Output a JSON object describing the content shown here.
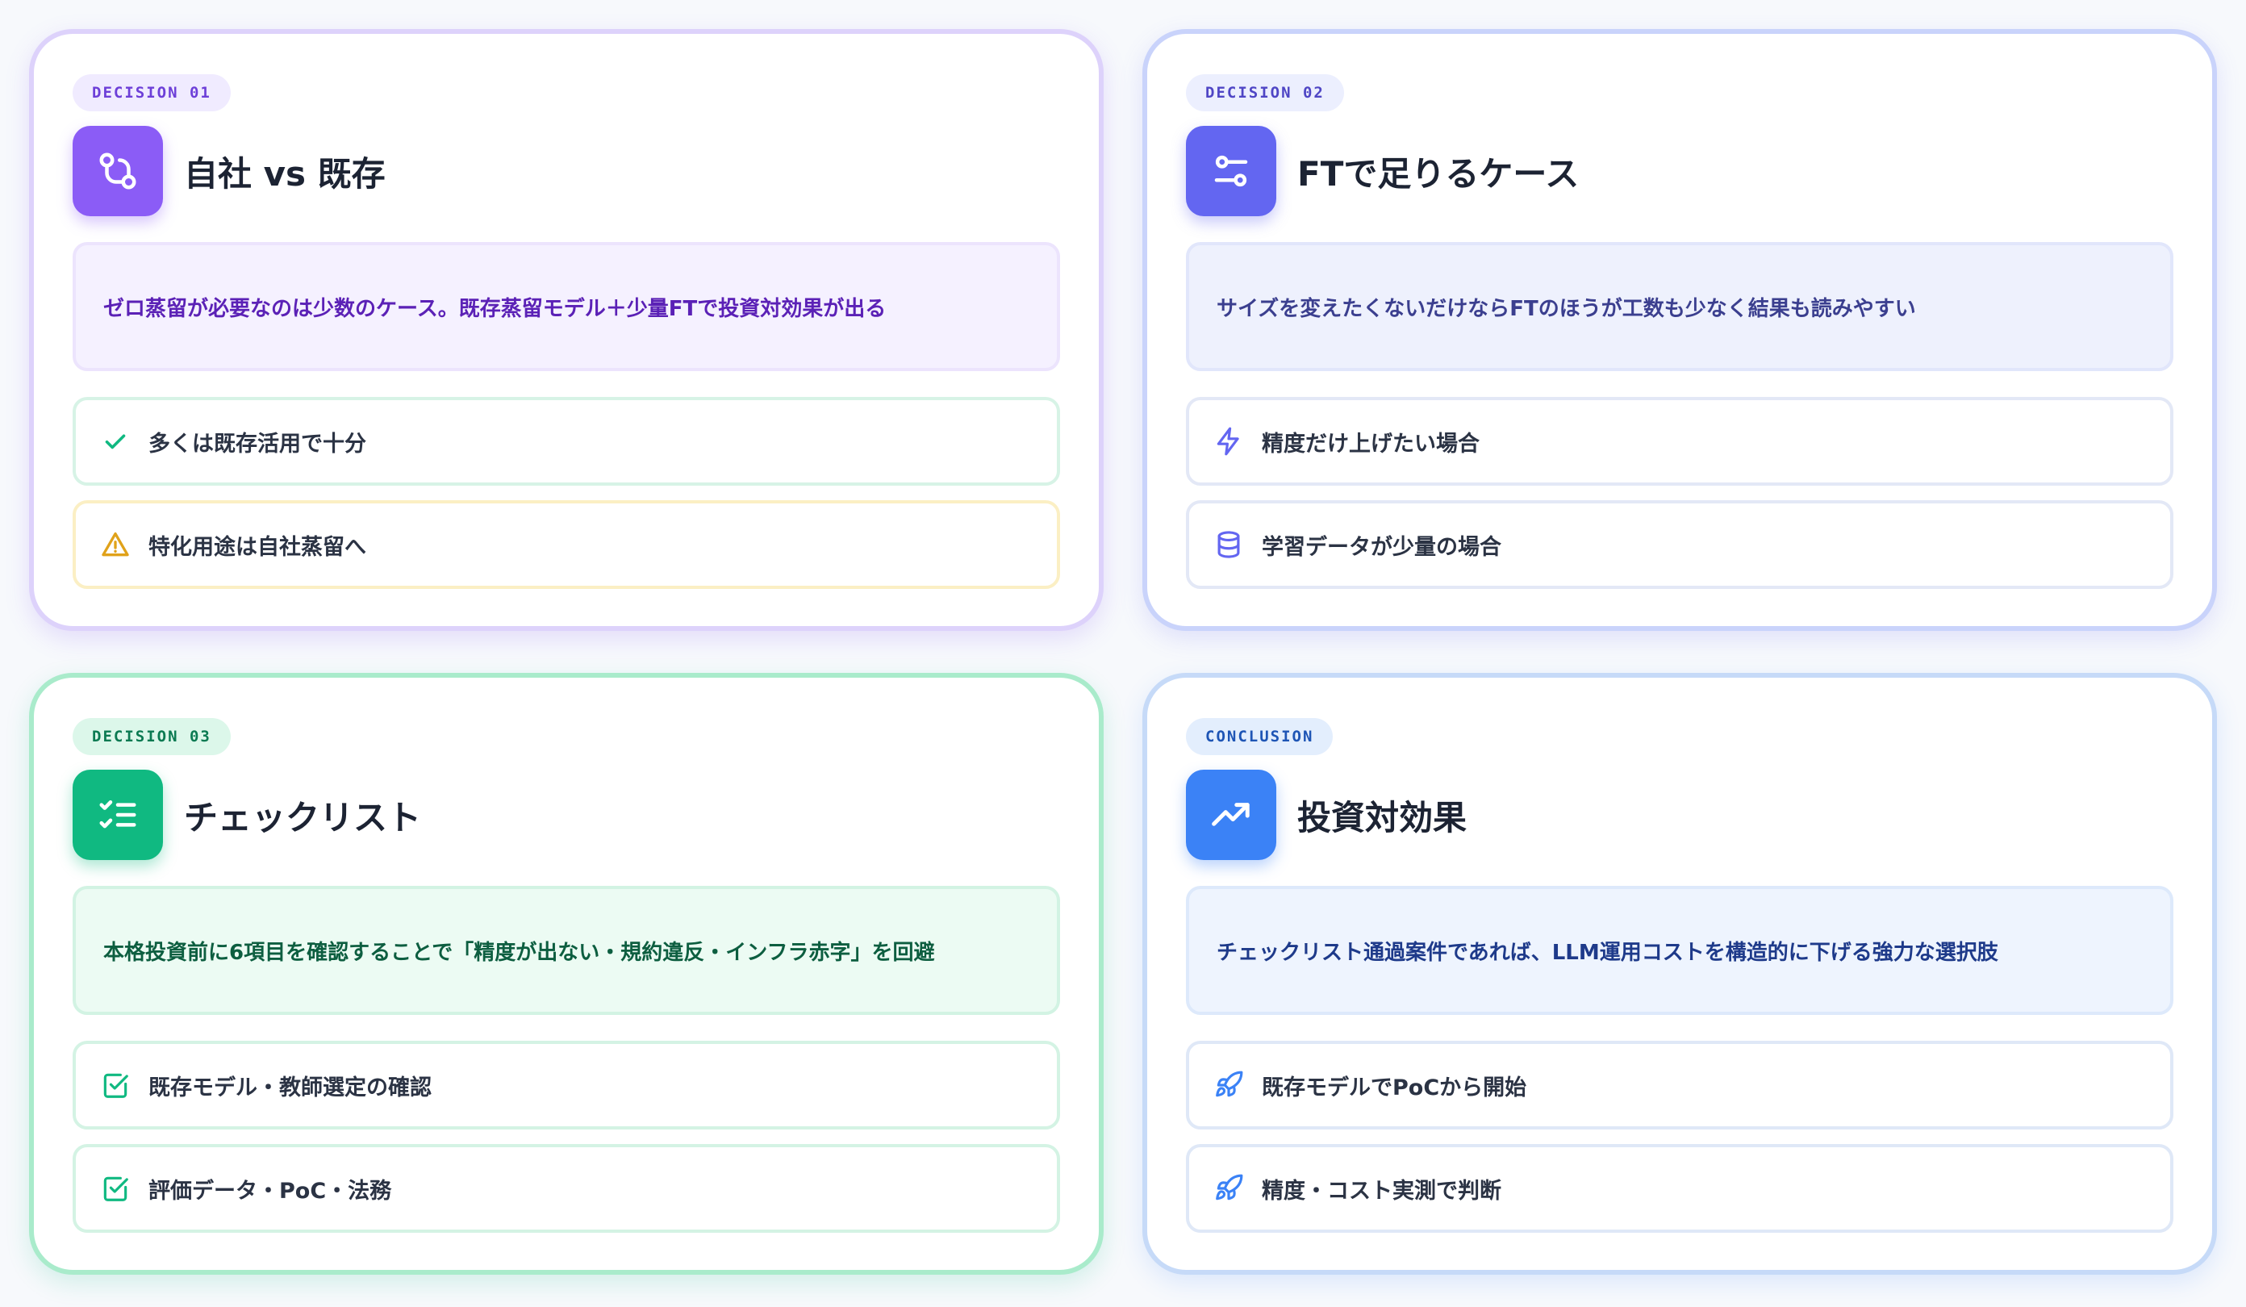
{
  "cards": [
    {
      "badge": "DECISION 01",
      "title": "自社 vs 既存",
      "icon": "git-compare-icon",
      "summary": "ゼロ蒸留が必要なのは少数のケース。既存蒸留モデル＋少量FTで投資対効果が出る",
      "items": [
        {
          "icon": "check-icon",
          "label": "多くは既存活用で十分"
        },
        {
          "icon": "warning-icon",
          "label": "特化用途は自社蒸留へ"
        }
      ]
    },
    {
      "badge": "DECISION 02",
      "title": "FTで足りるケース",
      "icon": "sliders-icon",
      "summary": "サイズを変えたくないだけならFTのほうが工数も少なく結果も読みやすい",
      "items": [
        {
          "icon": "lightning-icon",
          "label": "精度だけ上げたい場合"
        },
        {
          "icon": "database-icon",
          "label": "学習データが少量の場合"
        }
      ]
    },
    {
      "badge": "DECISION 03",
      "title": "チェックリスト",
      "icon": "checklist-icon",
      "summary": "本格投資前に6項目を確認することで「精度が出ない・規約違反・インフラ赤字」を回避",
      "items": [
        {
          "icon": "checkbox-icon",
          "label": "既存モデル・教師選定の確認"
        },
        {
          "icon": "checkbox-icon",
          "label": "評価データ・PoC・法務"
        }
      ]
    },
    {
      "badge": "CONCLUSION",
      "title": "投資対効果",
      "icon": "trending-up-icon",
      "summary": "チェックリスト通過案件であれば、LLM運用コストを構造的に下げる強力な選択肢",
      "items": [
        {
          "icon": "rocket-icon",
          "label": "既存モデルでPoCから開始"
        },
        {
          "icon": "rocket-icon",
          "label": "精度・コスト実測で判断"
        }
      ]
    }
  ],
  "colors": {
    "purple": "#8b5cf6",
    "indigo": "#6366f1",
    "green": "#10b981",
    "blue": "#3b82f6",
    "amber": "#e0a21a"
  }
}
